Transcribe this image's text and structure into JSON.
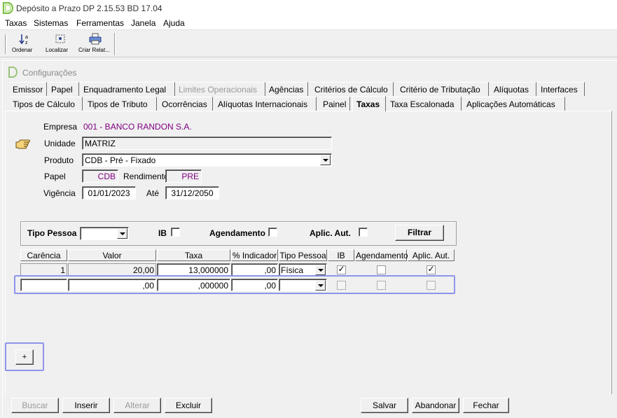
{
  "app": {
    "title": "Depósito a Prazo   DP 2.15.53 BD 17.04"
  },
  "menu": [
    "Taxas",
    "Sistemas",
    "Ferramentas",
    "Janela",
    "Ajuda"
  ],
  "toolbar": {
    "ordenar": "Ordenar",
    "localizar": "Localizar",
    "criar_relat": "Criar Relat..."
  },
  "window": {
    "title": "Configurações"
  },
  "tabs_row1": [
    "Emissor",
    "Papel",
    "Enquadramento Legal",
    "Limites Operacionais",
    "Agências",
    "Critérios de Cálculo",
    "Critério de Tributação",
    "Alíquotas",
    "Interfaces"
  ],
  "tabs_row2": [
    "Tipos de Cálculo",
    "Tipos de Tributo",
    "Ocorrências",
    "Alíquotas Internacionais",
    "Painel",
    "Taxas",
    "Taxa Escalonada",
    "Aplicações Automáticas"
  ],
  "form": {
    "empresa_label": "Empresa",
    "empresa_value": "001 - BANCO RANDON S.A.",
    "unidade_label": "Unidade",
    "unidade_value": "MATRIZ",
    "produto_label": "Produto",
    "produto_value": "CDB - Pré - Fixado",
    "papel_label": "Papel",
    "papel_value": "CDB",
    "rendimento_label": "Rendimento",
    "rendimento_value": "PRE",
    "vigencia_label": "Vigência",
    "vigencia_value": "01/01/2023",
    "ate_label": "Até",
    "ate_value": "31/12/2050"
  },
  "filter": {
    "tipo_pessoa_label": "Tipo Pessoa",
    "tipo_pessoa_value": "",
    "ib_label": "IB",
    "agendamento_label": "Agendamento",
    "aplic_aut_label": "Aplic. Aut.",
    "filtrar_label": "Filtrar"
  },
  "grid": {
    "columns": [
      "Carência",
      "Valor",
      "Taxa",
      "% Indicador",
      "Tipo Pessoa",
      "IB",
      "Agendamento",
      "Aplic. Aut."
    ],
    "rows": [
      {
        "carencia": "1",
        "valor": "20,00",
        "taxa": "13,000000",
        "indicador": ",00",
        "tipo_pessoa": "Física",
        "ib": true,
        "agendamento": false,
        "aplic_aut": true
      },
      {
        "carencia": "",
        "valor": ",00",
        "taxa": ",000000",
        "indicador": ",00",
        "tipo_pessoa": "",
        "ib": false,
        "agendamento": false,
        "aplic_aut": false
      }
    ]
  },
  "plus_button": "+",
  "bottom_buttons": {
    "buscar": "Buscar",
    "inserir": "Inserir",
    "alterar": "Alterar",
    "excluir": "Excluir",
    "salvar": "Salvar",
    "abandonar": "Abandonar",
    "fechar": "Fechar"
  },
  "colors": {
    "highlight": "#8f94ea",
    "value_purple": "#800080",
    "logo_green": "#7bc043"
  }
}
